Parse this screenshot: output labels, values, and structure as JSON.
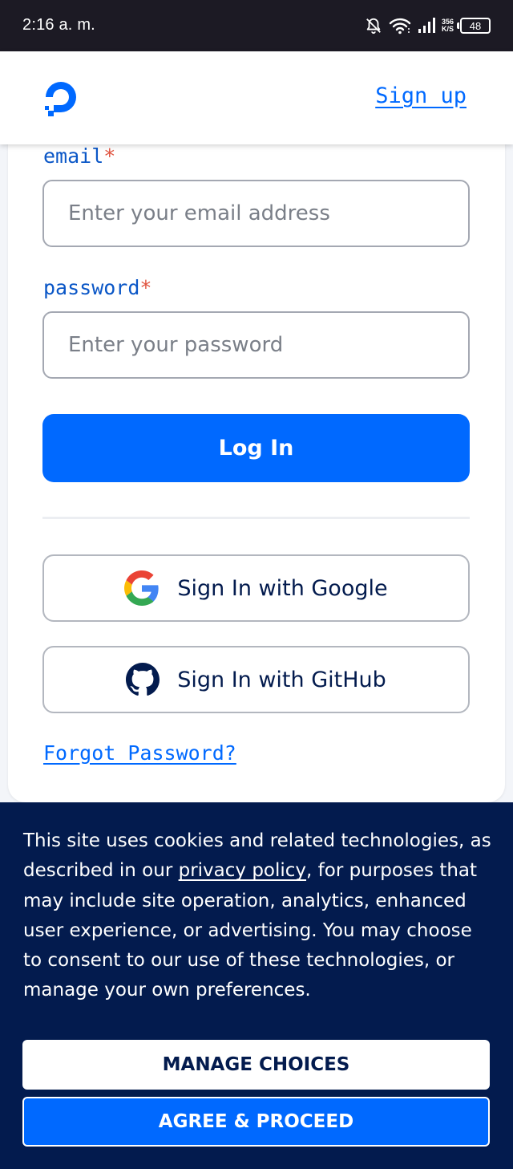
{
  "status_bar": {
    "time": "2:16 a. m.",
    "net_speed_value": "356",
    "net_speed_unit": "K/S",
    "battery": "48",
    "icons": [
      "bell-off-icon",
      "wifi-icon",
      "signal-icon",
      "battery-icon"
    ]
  },
  "header": {
    "logo": "digitalocean-logo",
    "signup_label": "Sign up"
  },
  "form": {
    "email_label": "email",
    "email_placeholder": "Enter your email address",
    "email_value": "",
    "password_label": "password",
    "password_placeholder": "Enter your password",
    "password_value": "",
    "required_marker": "*",
    "login_label": "Log In",
    "google_label": "Sign In with Google",
    "github_label": "Sign In with GitHub",
    "forgot_label": "Forgot Password?"
  },
  "cookie": {
    "text_before": "This site uses cookies and related technologies, as described in our ",
    "link": "privacy policy",
    "text_after": ", for purposes that may include site operation, analytics, enhanced user experience, or advertising. You may choose to consent to our use of these technologies, or manage your own preferences.",
    "manage_label": "MANAGE CHOICES",
    "agree_label": "AGREE & PROCEED"
  },
  "colors": {
    "brand_blue": "#0069ff",
    "navy": "#031b4e",
    "label_blue": "#0b57c7",
    "required_red": "#e0533f",
    "status_bar": "#1c1a24"
  }
}
